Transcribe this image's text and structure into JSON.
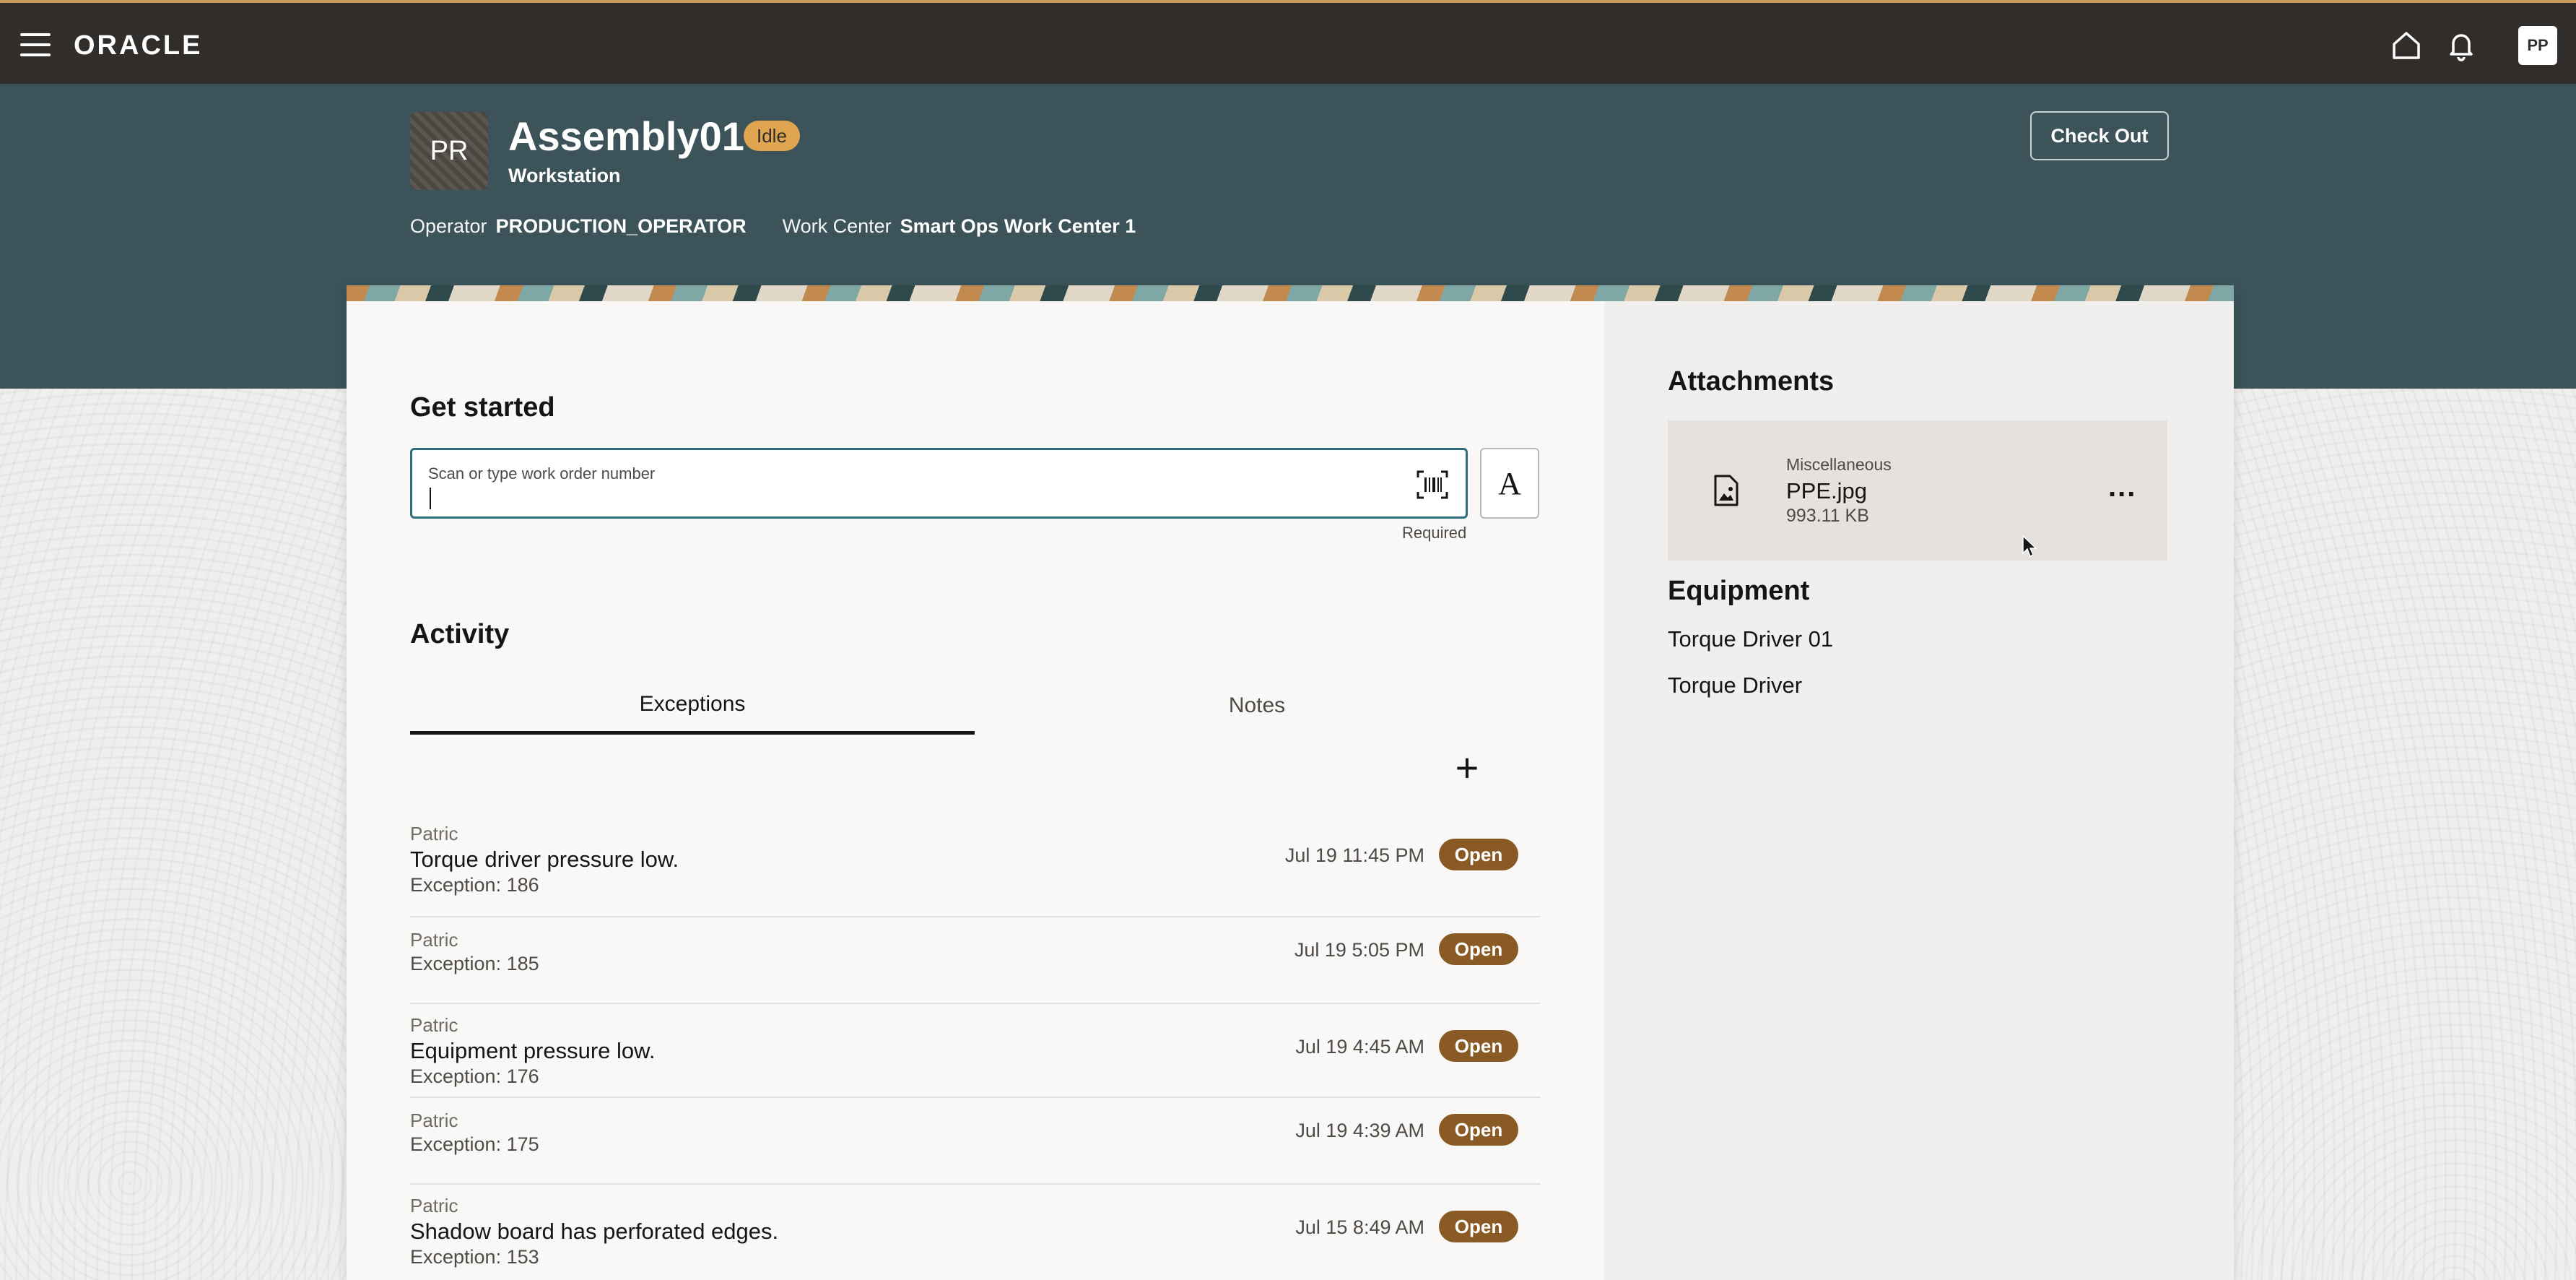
{
  "topbar": {
    "brand": "ORACLE",
    "user_initials": "PP",
    "icons": [
      "menu-icon",
      "home-icon",
      "bell-icon"
    ]
  },
  "header": {
    "avatar_initials": "PR",
    "title": "Assembly01",
    "status": "Idle",
    "subtitle": "Workstation",
    "operator_label": "Operator",
    "operator_value": "PRODUCTION_OPERATOR",
    "work_center_label": "Work Center",
    "work_center_value": "Smart Ops Work Center 1",
    "checkout_label": "Check Out"
  },
  "get_started": {
    "title": "Get started",
    "input_label": "Scan or type work order number",
    "input_value": "",
    "required_text": "Required",
    "font_button_label": "A"
  },
  "activity": {
    "title": "Activity",
    "tabs": [
      {
        "label": "Exceptions",
        "active": true
      },
      {
        "label": "Notes",
        "active": false
      }
    ],
    "add_label": "+",
    "exceptions": [
      {
        "author": "Patric",
        "description": "Torque driver pressure low.",
        "number": "Exception: 186",
        "time": "Jul 19 11:45 PM",
        "status": "Open"
      },
      {
        "author": "Patric",
        "description": "",
        "number": "Exception: 185",
        "time": "Jul 19 5:05 PM",
        "status": "Open"
      },
      {
        "author": "Patric",
        "description": "Equipment pressure low.",
        "number": "Exception: 176",
        "time": "Jul 19 4:45 AM",
        "status": "Open"
      },
      {
        "author": "Patric",
        "description": "",
        "number": "Exception: 175",
        "time": "Jul 19 4:39 AM",
        "status": "Open"
      },
      {
        "author": "Patric",
        "description": "Shadow board has perforated edges.",
        "number": "Exception: 153",
        "time": "Jul 15 8:49 AM",
        "status": "Open"
      }
    ]
  },
  "attachments": {
    "title": "Attachments",
    "items": [
      {
        "category": "Miscellaneous",
        "name": "PPE.jpg",
        "size": "993.11 KB",
        "more_label": "..."
      }
    ]
  },
  "equipment": {
    "title": "Equipment",
    "items": [
      "Torque Driver 01",
      "Torque Driver"
    ]
  },
  "colors": {
    "topbar": "#312d2a",
    "header": "#3b5359",
    "accent_focus": "#2d6d7c",
    "status_idle": "#e0a54f",
    "status_open": "#8a5a24"
  }
}
